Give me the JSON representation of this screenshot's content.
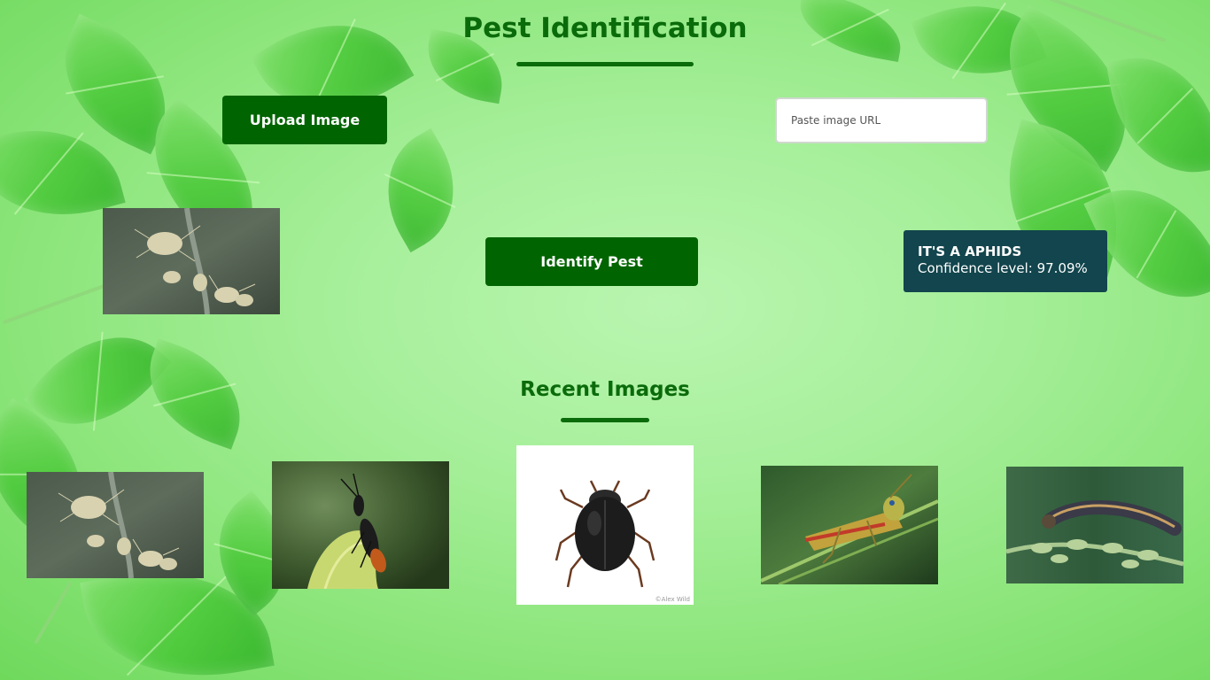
{
  "header": {
    "title": "Pest Identification"
  },
  "controls": {
    "upload_label": "Upload Image",
    "url_placeholder": "Paste image URL",
    "url_value": "",
    "identify_label": "Identify Pest"
  },
  "preview": {
    "image_icon": "aphids-photo"
  },
  "result": {
    "title": "IT'S A APHIDS",
    "confidence": "Confidence level: 97.09%"
  },
  "recent": {
    "title": "Recent Images",
    "images": [
      {
        "icon": "aphids-photo"
      },
      {
        "icon": "wasp-photo"
      },
      {
        "icon": "beetle-photo"
      },
      {
        "icon": "grasshopper-photo"
      },
      {
        "icon": "caterpillar-photo"
      }
    ],
    "watermarks": {
      "beetle": "©Alex Wild"
    }
  },
  "colors": {
    "accent": "#006400",
    "title": "#0a6b0a",
    "result_bg": "#12454d",
    "background": "#a6ef9a"
  }
}
